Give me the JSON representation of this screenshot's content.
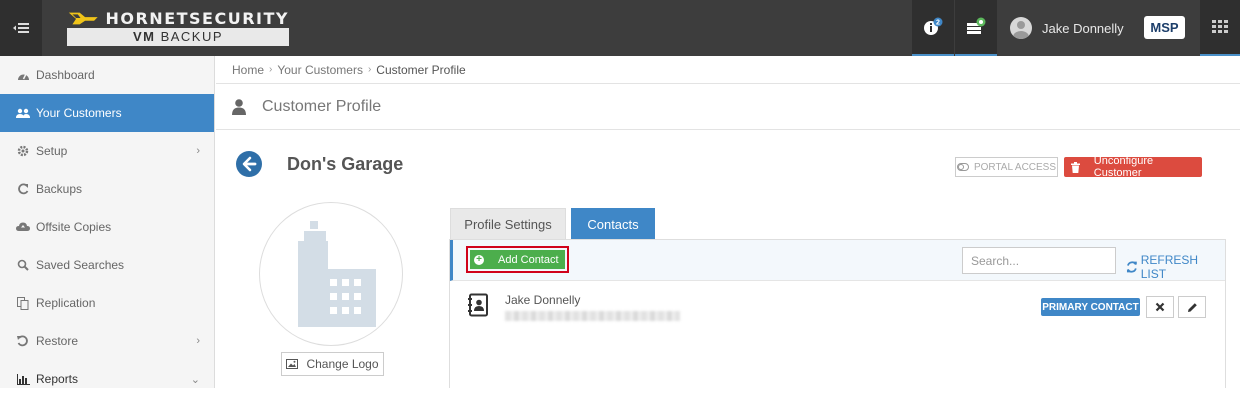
{
  "header": {
    "brand_name": "HORNETSECURITY",
    "brand_product_bold": "VM",
    "brand_product": " BACKUP",
    "notification_count": "2",
    "user_name": "Jake Donnelly",
    "msp_label": "MSP"
  },
  "sidebar": {
    "items": [
      {
        "label": "Dashboard",
        "icon": "dashboard-icon"
      },
      {
        "label": "Your Customers",
        "icon": "users-icon",
        "active": true
      },
      {
        "label": "Setup",
        "icon": "gear-icon",
        "chevron": "›"
      },
      {
        "label": "Backups",
        "icon": "refresh-icon"
      },
      {
        "label": "Offsite Copies",
        "icon": "cloud-upload-icon"
      },
      {
        "label": "Saved Searches",
        "icon": "search-icon"
      },
      {
        "label": "Replication",
        "icon": "copy-icon"
      },
      {
        "label": "Restore",
        "icon": "undo-icon",
        "chevron": "›"
      },
      {
        "label": "Reports",
        "icon": "bar-chart-icon",
        "chevron": "⌄"
      }
    ]
  },
  "breadcrumb": {
    "items": [
      "Home",
      "Your Customers",
      "Customer Profile"
    ],
    "separator": "›"
  },
  "page": {
    "title": "Customer Profile"
  },
  "customer": {
    "name": "Don's Garage",
    "portal_access_label": "PORTAL ACCESS",
    "unconfigure_label": "Unconfigure Customer",
    "change_logo_label": "Change Logo"
  },
  "tabs": [
    {
      "label": "Profile Settings",
      "active": false
    },
    {
      "label": "Contacts",
      "active": true
    }
  ],
  "contacts_panel": {
    "add_contact_label": "Add Contact",
    "search_placeholder": "Search...",
    "refresh_label": "REFRESH LIST",
    "contacts": [
      {
        "name": "Jake Donnelly",
        "badge": "PRIMARY CONTACT"
      }
    ]
  },
  "colors": {
    "accent": "#3f87c7",
    "danger": "#dc4b3f",
    "success": "#4cae4c",
    "topbar": "#3d3d3d"
  }
}
